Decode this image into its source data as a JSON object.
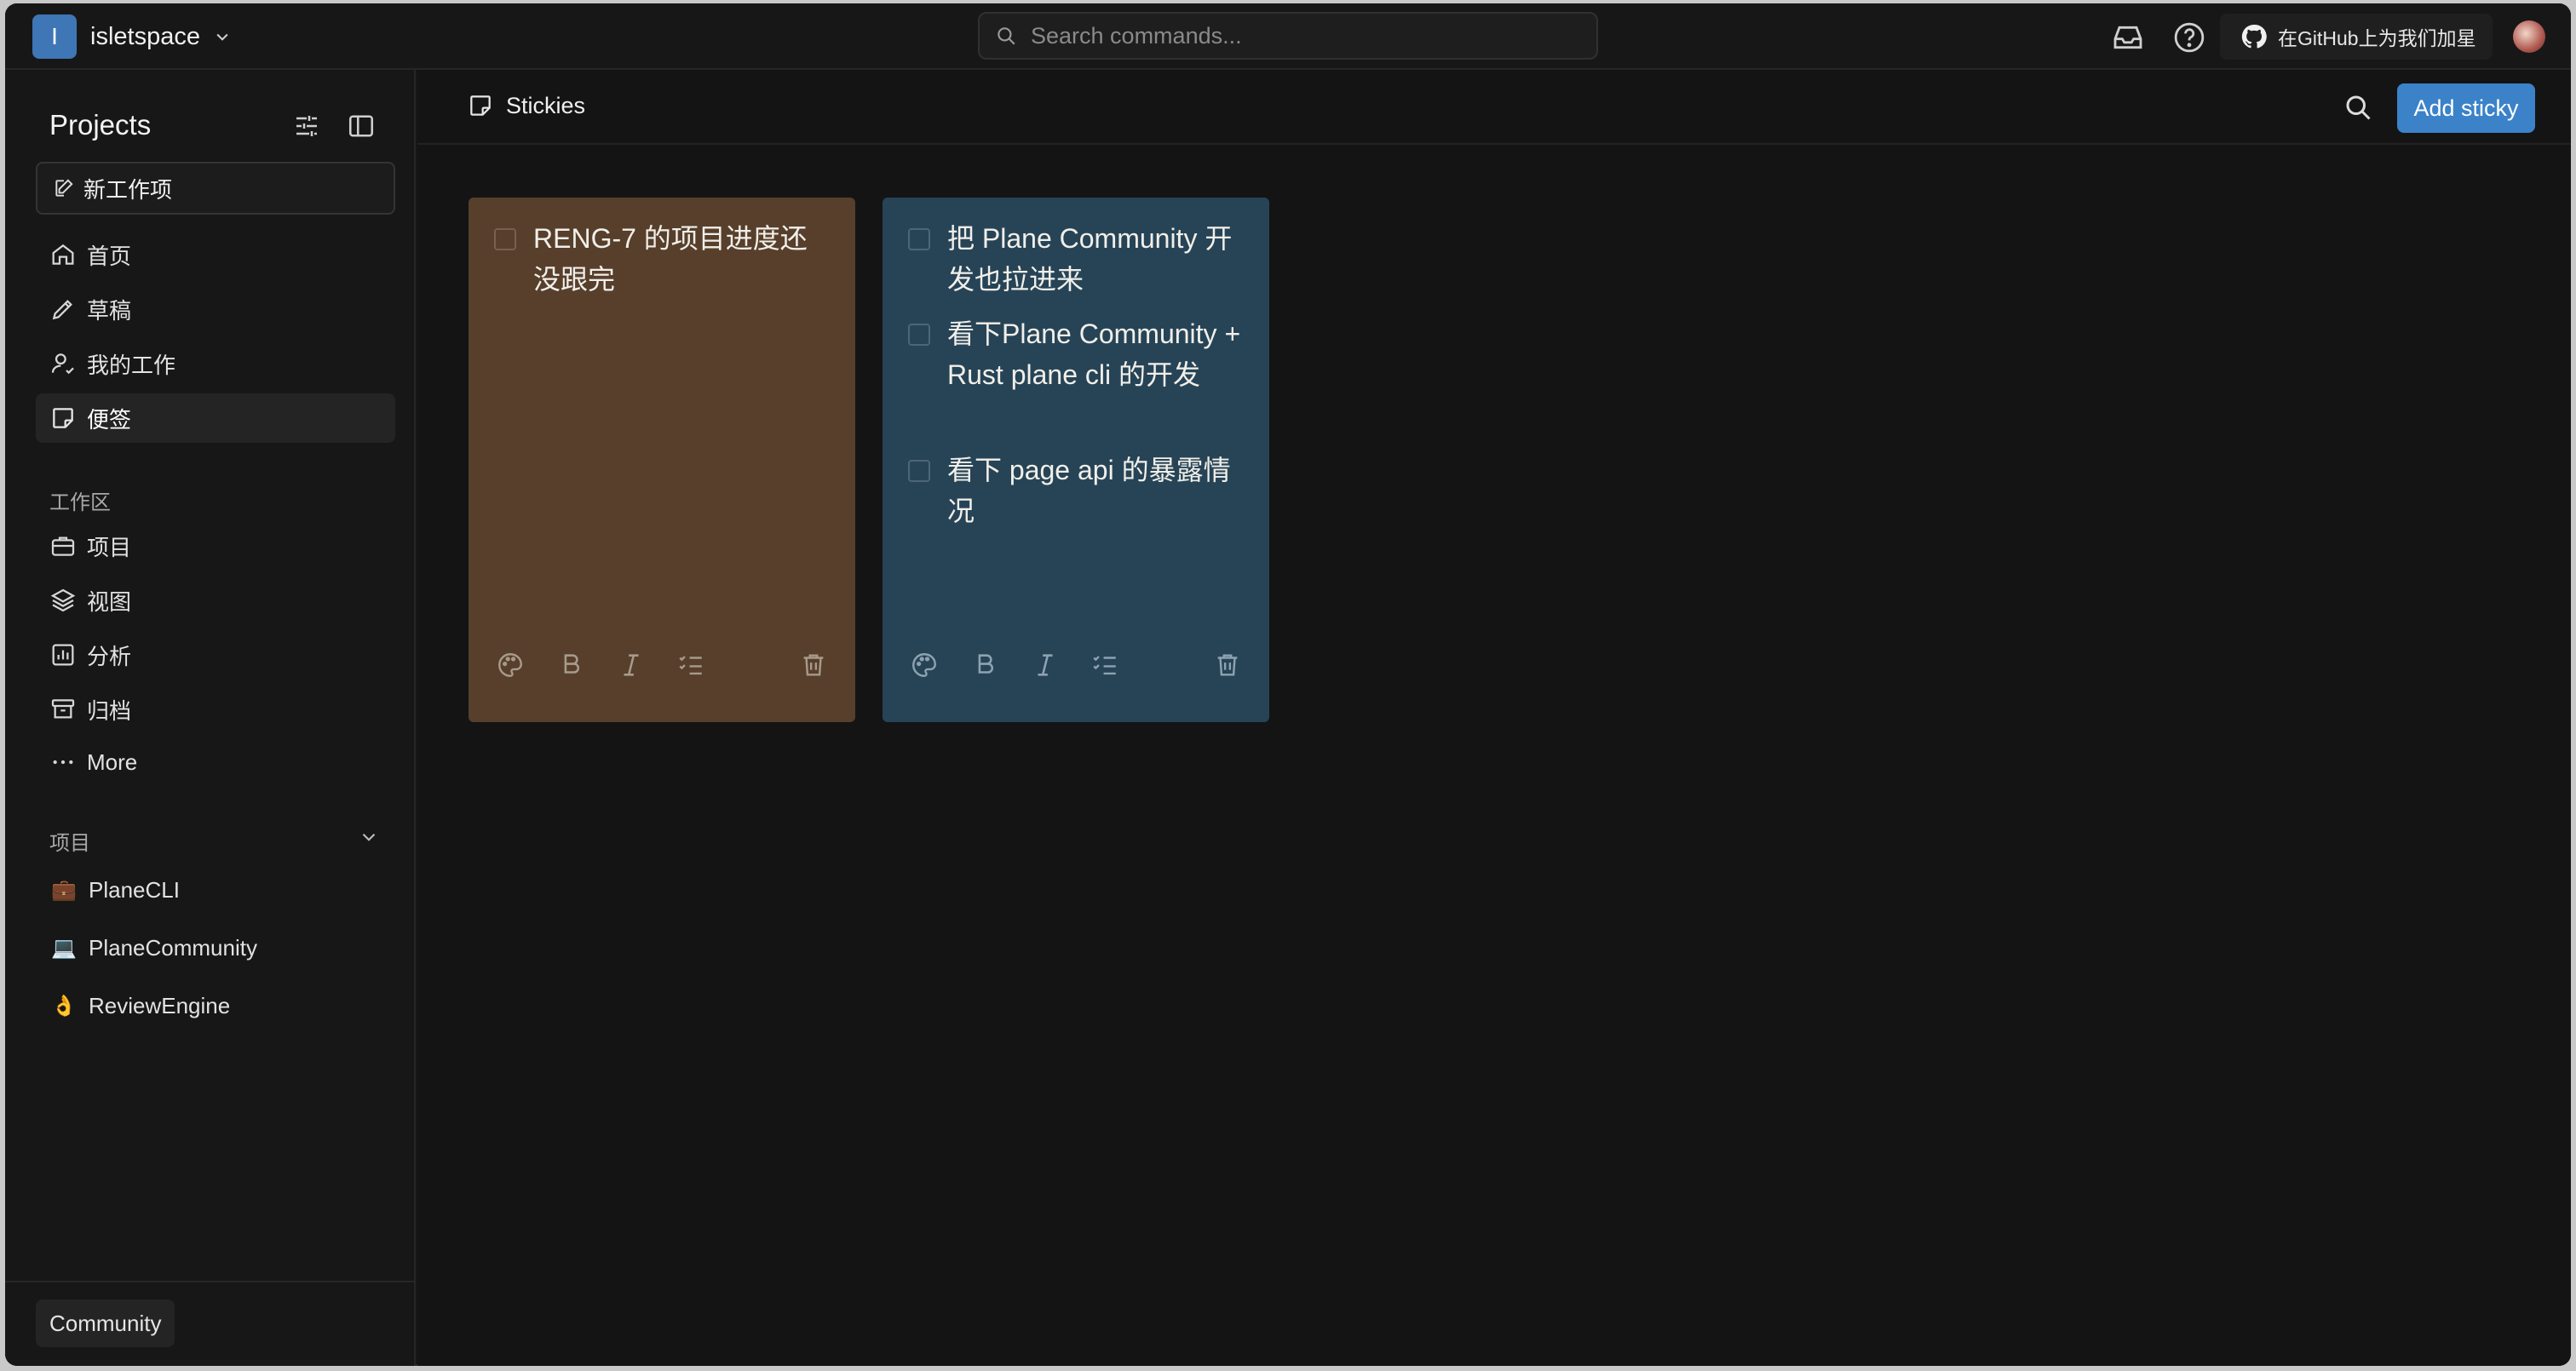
{
  "workspace": {
    "avatar_letter": "I",
    "name": "isletspace"
  },
  "search": {
    "placeholder": "Search commands..."
  },
  "topbar": {
    "github_label": "在GitHub上为我们加星"
  },
  "sidebar": {
    "title": "Projects",
    "new_item_label": "新工作项",
    "nav": [
      {
        "label": "首页",
        "icon": "home-icon"
      },
      {
        "label": "草稿",
        "icon": "pencil-icon"
      },
      {
        "label": "我的工作",
        "icon": "user-check-icon"
      },
      {
        "label": "便签",
        "icon": "sticky-note-icon",
        "active": true
      }
    ],
    "workspace_section": "工作区",
    "workspace_nav": [
      {
        "label": "项目",
        "icon": "briefcase-icon"
      },
      {
        "label": "视图",
        "icon": "layers-icon"
      },
      {
        "label": "分析",
        "icon": "bar-chart-icon"
      },
      {
        "label": "归档",
        "icon": "archive-icon"
      },
      {
        "label": "More",
        "icon": "more-icon"
      }
    ],
    "projects_section": "项目",
    "projects": [
      {
        "name": "PlaneCLI",
        "emoji": "💼"
      },
      {
        "name": "PlaneCommunity",
        "emoji": "💻"
      },
      {
        "name": "ReviewEngine",
        "emoji": "👌"
      }
    ],
    "footer_badge": "Community"
  },
  "main": {
    "title": "Stickies",
    "add_button": "Add sticky",
    "stickies": [
      {
        "color": "#573f2c",
        "tasks": [
          "RENG-7 的项目进度还没跟完"
        ]
      },
      {
        "color": "#274457",
        "tasks": [
          "把 Plane Community 开发也拉进来",
          "看下Plane Community + Rust plane cli 的开发",
          "看下 page api 的暴露情况"
        ]
      }
    ]
  }
}
